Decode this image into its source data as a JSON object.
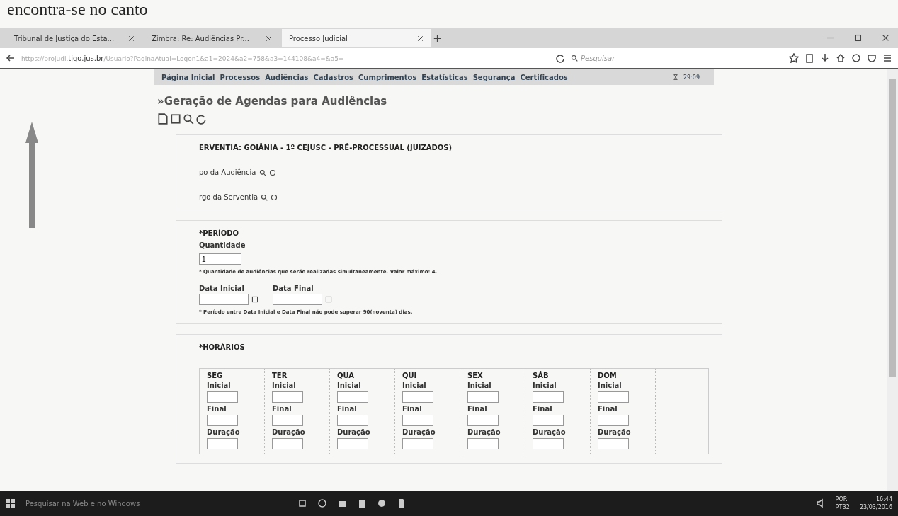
{
  "document_text": "encontra-se no canto",
  "browser": {
    "tabs": [
      {
        "title": "Tribunal de Justiça do Esta...",
        "selected": false
      },
      {
        "title": "Zimbra: Re: Audiências Pr...",
        "selected": false
      },
      {
        "title": "Processo Judicial",
        "selected": true
      }
    ],
    "url_dim": "https://projudi.",
    "url_host": "tjgo.jus.br",
    "url_path": "/Usuario?PaginaAtual=Logon1&a1=2024&a2=758&a3=144108&a4=&a5=",
    "search_placeholder": "Pesquisar"
  },
  "nav": {
    "items": [
      "Página Inicial",
      "Processos",
      "Audiências",
      "Cadastros",
      "Cumprimentos",
      "Estatísticas",
      "Segurança",
      "Certificados"
    ],
    "timer": "29:09"
  },
  "page_title": "»Geração de Agendas para Audiências",
  "serventia": {
    "heading": "ERVENTIA: GOIÂNIA - 1º CEJUSC - PRÉ-PROCESSUAL (JUIZADOS)",
    "fields": [
      "po da Audiência",
      "rgo da Serventia"
    ]
  },
  "periodo": {
    "legend": "*PERÍODO",
    "quantity_label": "Quantidade",
    "quantity_value": "1",
    "quantity_note": "* Quantidade de audiências que serão realizadas simultaneamente. Valor máximo: 4.",
    "start_label": "Data Inicial",
    "end_label": "Data Final",
    "date_note": "* Período entre Data Inicial e Data Final não pode superar 90(noventa) dias."
  },
  "horarios": {
    "legend": "*HORÁRIOS",
    "days": [
      {
        "day": "SEG",
        "fields": [
          "Inicial",
          "Final",
          "Duração"
        ]
      },
      {
        "day": "TER",
        "fields": [
          "Inicial",
          "Final",
          "Duração"
        ]
      },
      {
        "day": "QUA",
        "fields": [
          "Inicial",
          "Final",
          "Duração"
        ]
      },
      {
        "day": "QUI",
        "fields": [
          "Inicial",
          "Final",
          "Duração"
        ]
      },
      {
        "day": "SEX",
        "fields": [
          "Inicial",
          "Final",
          "Duração"
        ]
      },
      {
        "day": "SÁB",
        "fields": [
          "Inicial",
          "Final",
          "Duração"
        ]
      },
      {
        "day": "DOM",
        "fields": [
          "Inicial",
          "Final",
          "Duração"
        ]
      }
    ]
  },
  "taskbar": {
    "search_placeholder": "Pesquisar na Web e no Windows",
    "language": "POR",
    "layout": "PTB2",
    "time": "16:44",
    "date": "23/03/2016"
  }
}
